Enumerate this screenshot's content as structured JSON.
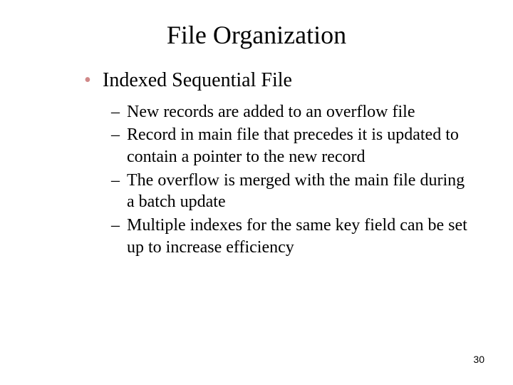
{
  "title": "File Organization",
  "main_bullet": "Indexed Sequential File",
  "sub_bullets": [
    "New records are added to an overflow file",
    "Record in main file that precedes it is updated to contain a pointer to the new record",
    "The overflow is merged with the main file during a batch update",
    "Multiple indexes for the same key field can be set up to increase efficiency"
  ],
  "page_number": "30"
}
